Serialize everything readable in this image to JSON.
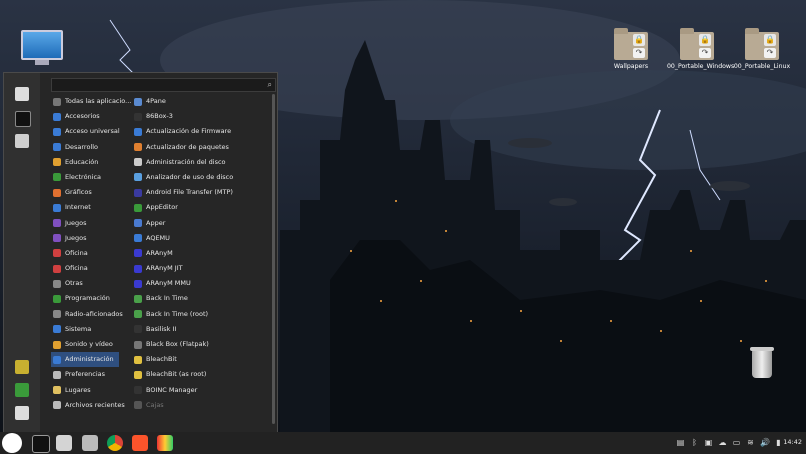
{
  "desktop": {
    "icons": [
      {
        "label": ""
      },
      {
        "label": "Wallpapers"
      },
      {
        "label": "00_Portable_Windows"
      },
      {
        "label": "00_Portable_Linux"
      }
    ]
  },
  "menu": {
    "search_value": "",
    "categories": [
      "Todas las aplicacio...",
      "Accesorios",
      "Acceso universal",
      "Desarrollo",
      "Educación",
      "Electrónica",
      "Gráficos",
      "Internet",
      "Juegos",
      "Juegos",
      "Oficina",
      "Oficina",
      "Otras",
      "Programación",
      "Radio-aficionados",
      "Sistema",
      "Sonido y vídeo",
      "Administración",
      "Preferencias",
      "Lugares",
      "Archivos recientes"
    ],
    "selected_category": "Administración",
    "apps": [
      "4Pane",
      "86Box-3",
      "Actualización de Firmware",
      "Actualizador de paquetes",
      "Administración del disco",
      "Analizador de uso de disco",
      "Android File Transfer (MTP)",
      "AppEditor",
      "Apper",
      "AQEMU",
      "ARAnyM",
      "ARAnyM JIT",
      "ARAnyM MMU",
      "Back In Time",
      "Back In Time (root)",
      "Basilisk II",
      "Black Box (Flatpak)",
      "BleachBit",
      "BleachBit (as root)",
      "BOINC Manager",
      "Cajas"
    ],
    "dim_app": "Cajas"
  },
  "taskbar": {
    "clock": "14:42"
  },
  "colors": {
    "menu_bg": "#262626",
    "selection": "#2f4f7f",
    "taskbar": "#222222"
  }
}
